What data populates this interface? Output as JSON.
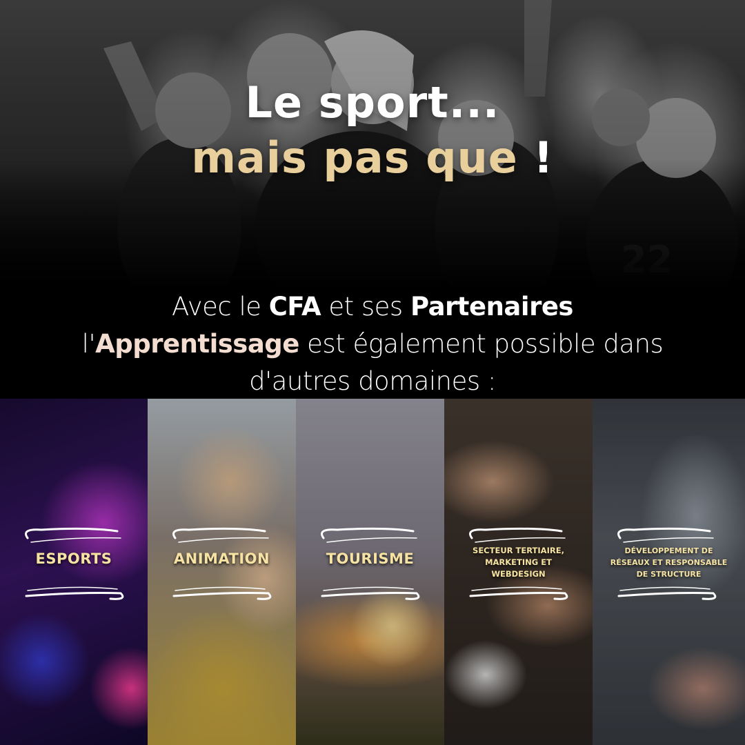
{
  "headline": {
    "line1": "Le sport...",
    "line2": "mais pas que",
    "line2_excl": "!"
  },
  "intro": {
    "line1_a": "Avec le ",
    "line1_b": "CFA",
    "line1_c": " et ses ",
    "line1_d": "Partenaires",
    "line2_a": "l'",
    "line2_b": "Apprentissage",
    "line2_c": " est également possible dans",
    "line3": "d'autres domaines :"
  },
  "panels": [
    {
      "label": "ESPORTS"
    },
    {
      "label": "ANIMATION"
    },
    {
      "label": "TOURISME"
    },
    {
      "label": "SECTEUR TERTIAIRE,\nMARKETING ET\nWEBDESIGN"
    },
    {
      "label": "DÉVELOPPEMENT DE\nRÉSEAUX ET RESPONSABLE\nDE STRUCTURE"
    }
  ],
  "colors": {
    "gold": "#e8cf9c",
    "label_yellow": "#f6e3a3",
    "accent_pink": "#f3dcd0"
  }
}
